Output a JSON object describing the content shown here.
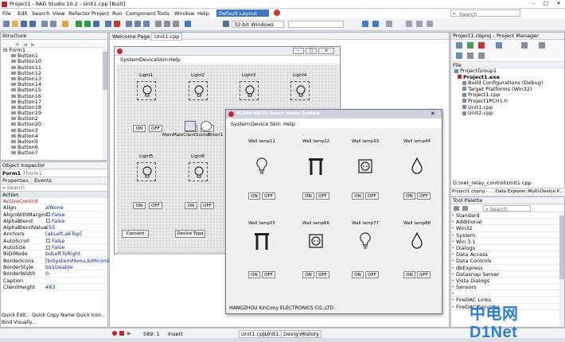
{
  "titlebar": {
    "title": "Project1 - RAD Studio 10.2 - Unit1.cpp [Built]"
  },
  "menu": {
    "file": "File",
    "edit": "Edit",
    "search": "Search",
    "view": "View",
    "refactor": "Refactor",
    "project": "Project",
    "run": "Run",
    "component": "Component",
    "tools": "Tools",
    "window": "Window",
    "help": "Help"
  },
  "toolbar": {
    "layout": "Default Layout",
    "platform": "32-bit Windows",
    "search_placeholder": "Search"
  },
  "structure": {
    "title": "Structure",
    "root": "Form1",
    "items": [
      "Button1",
      "Button10",
      "Button11",
      "Button12",
      "Button13",
      "Button14",
      "Button15",
      "Button16",
      "Button17",
      "Button18",
      "Button19",
      "Button2",
      "Button20",
      "Button3",
      "Button4",
      "Button5",
      "Button6",
      "Button7"
    ]
  },
  "inspector": {
    "title": "Object Inspector",
    "object": "Form1",
    "class": "TForm1",
    "tab_properties": "Properties",
    "tab_events": "Events",
    "search_placeholder": "Search",
    "section": "Action",
    "rows": [
      {
        "k": "ActiveControl",
        "v": ""
      },
      {
        "k": "Align",
        "v": "alNone"
      },
      {
        "k": "AlignWithMargins",
        "v": "False"
      },
      {
        "k": "AlphaBlend",
        "v": "False"
      },
      {
        "k": "AlphaBlendValue",
        "v": "255"
      },
      {
        "k": "Anchors",
        "v": "[akLeft,akTop]"
      },
      {
        "k": "AutoScroll",
        "v": "False"
      },
      {
        "k": "AutoSize",
        "v": "False"
      },
      {
        "k": "BiDiMode",
        "v": "bdLeftToRight"
      },
      {
        "k": "BorderIcons",
        "v": "[biSystemMenu,biMinimize"
      },
      {
        "k": "BorderStyle",
        "v": "bsSizeable"
      },
      {
        "k": "BorderWidth",
        "v": "0"
      },
      {
        "k": "Caption",
        "v": ""
      },
      {
        "k": "ClientHeight",
        "v": "483"
      }
    ],
    "quick": "Quick Edit...  Quick Copy Name  Quick Icon...",
    "bind": "Bind Visually..."
  },
  "tabs": {
    "welcome": "Welcome Page",
    "unit1": "Unit1.cpp"
  },
  "designer": {
    "menu": [
      "System",
      "Device",
      "Skin",
      "Help"
    ],
    "lights": [
      "Light1",
      "Light2",
      "Light3",
      "Light4",
      "Light5",
      "Light6"
    ],
    "on": "ON",
    "off": "OFF",
    "socket": "MainMainClientSocket",
    "timer": "Timer1",
    "connect": "Connect",
    "device_type": "Device Type"
  },
  "app": {
    "title": "KC868-H8/32 Smart Home System",
    "menu": [
      "System",
      "Device",
      "Skin",
      "Help"
    ],
    "lamps": [
      {
        "name": "Wall lamp11",
        "icon": "bulb"
      },
      {
        "name": "Wall lamp22",
        "icon": "door"
      },
      {
        "name": "Wall lamp33",
        "icon": "socket"
      },
      {
        "name": "Wall lamp44",
        "icon": "drop"
      },
      {
        "name": "Wall lamp55",
        "icon": "door"
      },
      {
        "name": "Wall lamp66",
        "icon": "socket"
      },
      {
        "name": "Wall lamp77",
        "icon": "bulb"
      },
      {
        "name": "Wall lamp88",
        "icon": "drop"
      }
    ],
    "on": "ON",
    "off": "OFF",
    "footer": "HANGZHOU KinCony ELECTRONICS CO.,LTD"
  },
  "project_manager": {
    "title": "Project1.cbproj - Project Manager",
    "file_label": "File",
    "items": [
      "ProjectGroup1",
      "Project1.exe",
      "Build Configurations (Debug)",
      "Target Platforms (Win32)",
      "Project1.cpp",
      "Project1PCH1.h",
      "Unit1.cpp",
      "Unit2.cpp"
    ],
    "path": "G:\\net_relay_control\\Unit1.cpp",
    "tabs": [
      "Project1.cbproj - ...",
      "Data Explorer",
      "Multi-Device P..."
    ]
  },
  "palette": {
    "title": "Tool Palette",
    "search_placeholder": "Search",
    "items": [
      "Standard",
      "Additional",
      "Win32",
      "System",
      "Win 3.1",
      "Dialogs",
      "Data Access",
      "Data Controls",
      "dbExpress",
      "Datasnap Server",
      "Vista Dialogs",
      "Sensors",
      "",
      "FireDAC Links",
      "FireDAC Services"
    ]
  },
  "status": {
    "pos": "569:  1",
    "mode": "Insert",
    "tabs": [
      "Unit1.cpp",
      "Unit1.h",
      "Design",
      "History"
    ]
  },
  "watermark": "中电网 D1Net"
}
